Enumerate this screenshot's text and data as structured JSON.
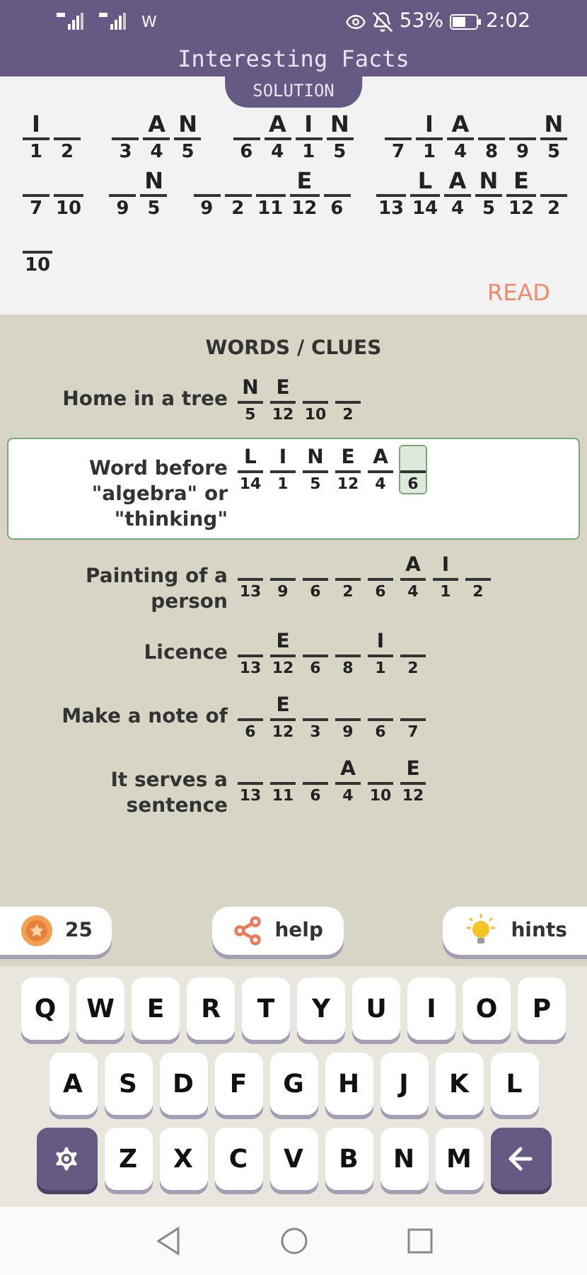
{
  "status_bar": {
    "carrier": "W",
    "battery": "53%",
    "time": "2:02"
  },
  "header": {
    "title": "Interesting Facts",
    "tab": "SOLUTION"
  },
  "solution": {
    "lines": [
      [
        [
          {
            "letter": "I",
            "number": "1"
          },
          {
            "number": "2"
          }
        ],
        [
          {
            "number": "3"
          },
          {
            "letter": "A",
            "number": "4"
          },
          {
            "letter": "N",
            "number": "5"
          }
        ],
        [
          {
            "number": "6"
          },
          {
            "letter": "A",
            "number": "4"
          },
          {
            "letter": "I",
            "number": "1"
          },
          {
            "letter": "N",
            "number": "5"
          }
        ],
        [
          {
            "number": "7"
          },
          {
            "letter": "I",
            "number": "1"
          },
          {
            "letter": "A",
            "number": "4"
          },
          {
            "number": "8"
          },
          {
            "number": "9"
          },
          {
            "letter": "N",
            "number": "5"
          }
        ]
      ],
      [
        [
          {
            "number": "7"
          },
          {
            "number": "10"
          }
        ],
        [
          {
            "number": "9"
          },
          {
            "letter": "N",
            "number": "5"
          }
        ],
        [
          {
            "number": "9"
          },
          {
            "number": "2"
          },
          {
            "number": "11"
          },
          {
            "letter": "E",
            "number": "12"
          },
          {
            "number": "6"
          }
        ],
        [
          {
            "number": "13"
          },
          {
            "letter": "L",
            "number": "14"
          },
          {
            "letter": "A",
            "number": "4"
          },
          {
            "letter": "N",
            "number": "5"
          },
          {
            "letter": "E",
            "number": "12"
          },
          {
            "number": "2"
          }
        ]
      ],
      [
        [
          {
            "number": "10"
          }
        ]
      ]
    ],
    "read": "READ"
  },
  "clues": {
    "title": "WORDS / CLUES",
    "items": [
      {
        "text": "Home in a tree",
        "selected": false,
        "cells": [
          {
            "letter": "N",
            "number": "5",
            "active": false
          },
          {
            "letter": "E",
            "number": "12",
            "active": false
          },
          {
            "number": "10",
            "active": false
          },
          {
            "number": "2",
            "active": false
          }
        ]
      },
      {
        "text": "Word before \"algebra\" or \"thinking\"",
        "selected": true,
        "cells": [
          {
            "letter": "L",
            "number": "14",
            "active": false
          },
          {
            "letter": "I",
            "number": "1",
            "active": false
          },
          {
            "letter": "N",
            "number": "5",
            "active": false
          },
          {
            "letter": "E",
            "number": "12",
            "active": false
          },
          {
            "letter": "A",
            "number": "4",
            "active": false
          },
          {
            "number": "6",
            "active": true
          }
        ]
      },
      {
        "text": "Painting of a person",
        "selected": false,
        "cells": [
          {
            "number": "13",
            "active": false
          },
          {
            "number": "9",
            "active": false
          },
          {
            "number": "6",
            "active": false
          },
          {
            "number": "2",
            "active": false
          },
          {
            "number": "6",
            "active": false
          },
          {
            "letter": "A",
            "number": "4",
            "active": false
          },
          {
            "letter": "I",
            "number": "1",
            "active": false
          },
          {
            "number": "2",
            "active": false
          }
        ]
      },
      {
        "text": "Licence",
        "selected": false,
        "cells": [
          {
            "number": "13",
            "active": false
          },
          {
            "letter": "E",
            "number": "12",
            "active": false
          },
          {
            "number": "6",
            "active": false
          },
          {
            "number": "8",
            "active": false
          },
          {
            "letter": "I",
            "number": "1",
            "active": false
          },
          {
            "number": "2",
            "active": false
          }
        ]
      },
      {
        "text": "Make a note of",
        "selected": false,
        "cells": [
          {
            "number": "6",
            "active": false
          },
          {
            "letter": "E",
            "number": "12",
            "active": false
          },
          {
            "number": "3",
            "active": false
          },
          {
            "number": "9",
            "active": false
          },
          {
            "number": "6",
            "active": false
          },
          {
            "number": "7",
            "active": false
          }
        ]
      },
      {
        "text": "It serves a sentence",
        "selected": false,
        "cells": [
          {
            "number": "13",
            "active": false
          },
          {
            "number": "11",
            "active": false
          },
          {
            "number": "6",
            "active": false
          },
          {
            "letter": "A",
            "number": "4",
            "active": false
          },
          {
            "number": "10",
            "active": false
          },
          {
            "letter": "E",
            "number": "12",
            "active": false
          }
        ]
      }
    ]
  },
  "toolbar": {
    "coins": "25",
    "help": "help",
    "hints": "hints"
  },
  "keyboard": {
    "rows": [
      [
        {
          "kind": "letter",
          "label": "Q"
        },
        {
          "kind": "letter",
          "label": "W"
        },
        {
          "kind": "letter",
          "label": "E"
        },
        {
          "kind": "letter",
          "label": "R"
        },
        {
          "kind": "letter",
          "label": "T"
        },
        {
          "kind": "letter",
          "label": "Y"
        },
        {
          "kind": "letter",
          "label": "U"
        },
        {
          "kind": "letter",
          "label": "I"
        },
        {
          "kind": "letter",
          "label": "O"
        },
        {
          "kind": "letter",
          "label": "P"
        }
      ],
      [
        {
          "kind": "letter",
          "label": "A"
        },
        {
          "kind": "letter",
          "label": "S"
        },
        {
          "kind": "letter",
          "label": "D"
        },
        {
          "kind": "letter",
          "label": "F"
        },
        {
          "kind": "letter",
          "label": "G"
        },
        {
          "kind": "letter",
          "label": "H"
        },
        {
          "kind": "letter",
          "label": "J"
        },
        {
          "kind": "letter",
          "label": "K"
        },
        {
          "kind": "letter",
          "label": "L"
        }
      ],
      [
        {
          "kind": "settings"
        },
        {
          "kind": "letter",
          "label": "Z"
        },
        {
          "kind": "letter",
          "label": "X"
        },
        {
          "kind": "letter",
          "label": "C"
        },
        {
          "kind": "letter",
          "label": "V"
        },
        {
          "kind": "letter",
          "label": "B"
        },
        {
          "kind": "letter",
          "label": "N"
        },
        {
          "kind": "letter",
          "label": "M"
        },
        {
          "kind": "backspace"
        }
      ]
    ]
  }
}
